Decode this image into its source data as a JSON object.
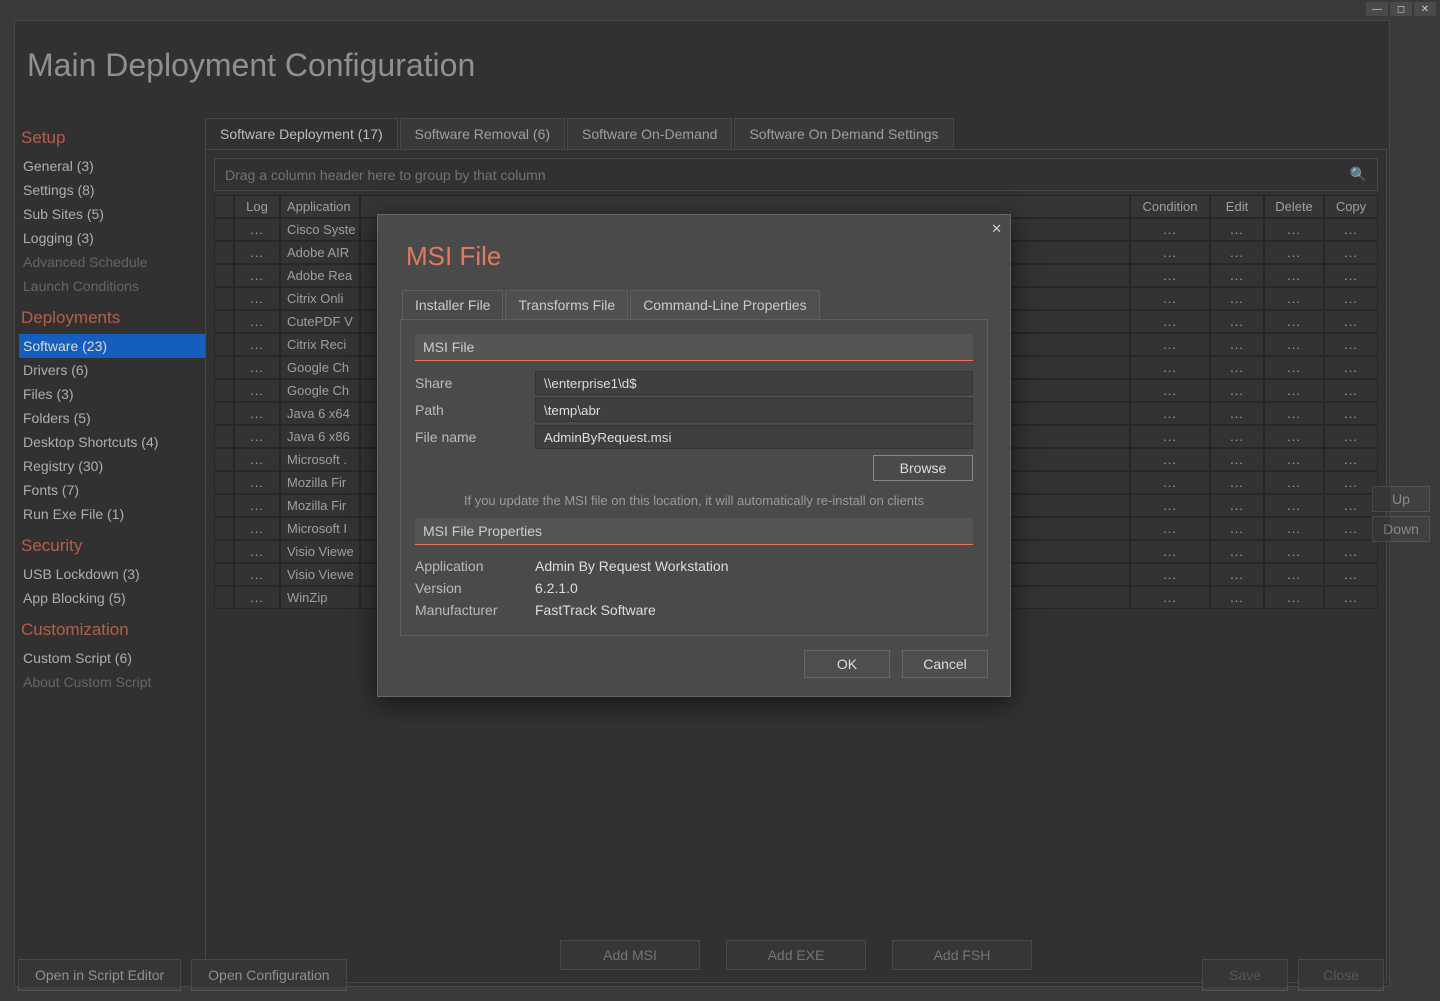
{
  "page_title": "Main Deployment Configuration",
  "sidebar": {
    "setup": {
      "heading": "Setup",
      "items": [
        {
          "label": "General (3)",
          "dim": false
        },
        {
          "label": "Settings (8)",
          "dim": false
        },
        {
          "label": "Sub Sites (5)",
          "dim": false
        },
        {
          "label": "Logging (3)",
          "dim": false
        },
        {
          "label": "Advanced Schedule",
          "dim": true
        },
        {
          "label": "Launch Conditions",
          "dim": true
        }
      ]
    },
    "deployments": {
      "heading": "Deployments",
      "items": [
        {
          "label": "Software (23)",
          "active": true
        },
        {
          "label": "Drivers (6)"
        },
        {
          "label": "Files (3)"
        },
        {
          "label": "Folders (5)"
        },
        {
          "label": "Desktop Shortcuts (4)"
        },
        {
          "label": "Registry (30)"
        },
        {
          "label": "Fonts (7)"
        },
        {
          "label": "Run Exe File (1)"
        }
      ]
    },
    "security": {
      "heading": "Security",
      "items": [
        {
          "label": "USB Lockdown (3)"
        },
        {
          "label": "App Blocking (5)"
        }
      ]
    },
    "customization": {
      "heading": "Customization",
      "items": [
        {
          "label": "Custom Script (6)"
        },
        {
          "label": "About Custom Script",
          "dim": true
        }
      ]
    }
  },
  "tabs": [
    {
      "label": "Software Deployment (17)",
      "active": true
    },
    {
      "label": "Software Removal (6)"
    },
    {
      "label": "Software On-Demand"
    },
    {
      "label": "Software On Demand Settings"
    }
  ],
  "group_hint": "Drag a column header here to group by that column",
  "columns": {
    "log": "Log",
    "application": "Application",
    "condition": "Condition",
    "edit": "Edit",
    "delete": "Delete",
    "copy": "Copy"
  },
  "rows": [
    {
      "app": "Cisco Syste"
    },
    {
      "app": "Adobe AIR"
    },
    {
      "app": "Adobe Rea"
    },
    {
      "app": "Citrix Onli"
    },
    {
      "app": "CutePDF V"
    },
    {
      "app": "Citrix Reci"
    },
    {
      "app": "Google Ch"
    },
    {
      "app": "Google Ch"
    },
    {
      "app": "Java 6 x64"
    },
    {
      "app": "Java 6 x86"
    },
    {
      "app": "Microsoft ."
    },
    {
      "app": "Mozilla Fir"
    },
    {
      "app": "Mozilla Fir"
    },
    {
      "app": "Microsoft I"
    },
    {
      "app": "Visio Viewe"
    },
    {
      "app": "Visio Viewe"
    },
    {
      "app": "WinZip"
    }
  ],
  "bottom_buttons": {
    "add_msi": "Add MSI",
    "add_exe": "Add EXE",
    "add_fsh": "Add FSH"
  },
  "updown": {
    "up": "Up",
    "down": "Down"
  },
  "footer": {
    "open_script": "Open in Script Editor",
    "open_config": "Open Configuration",
    "save": "Save",
    "close": "Close"
  },
  "modal": {
    "title": "MSI File",
    "tabs": [
      {
        "label": "Installer File",
        "active": true
      },
      {
        "label": "Transforms File"
      },
      {
        "label": "Command-Line Properties"
      }
    ],
    "section1": "MSI File",
    "share_label": "Share",
    "share_value": "\\\\enterprise1\\d$",
    "path_label": "Path",
    "path_value": "\\temp\\abr",
    "file_label": "File name",
    "file_value": "AdminByRequest.msi",
    "browse": "Browse",
    "hint": "If you update the MSI file on this location, it will automatically re-install on clients",
    "section2": "MSI File Properties",
    "app_label": "Application",
    "app_value": "Admin By Request Workstation",
    "ver_label": "Version",
    "ver_value": "6.2.1.0",
    "man_label": "Manufacturer",
    "man_value": "FastTrack Software",
    "ok": "OK",
    "cancel": "Cancel"
  }
}
